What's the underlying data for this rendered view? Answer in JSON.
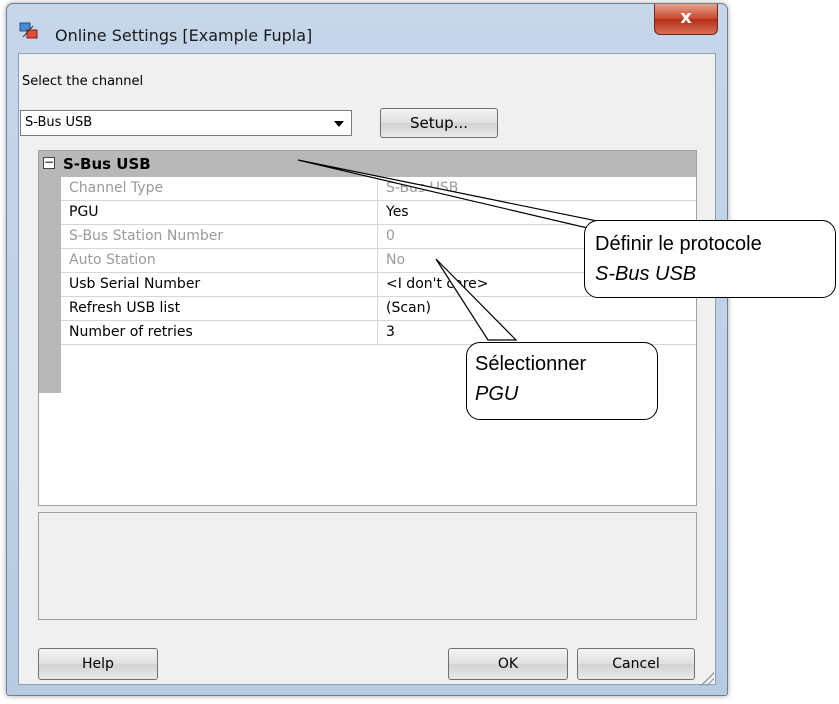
{
  "window": {
    "title": "Online Settings [Example Fupla]",
    "close_label": "x"
  },
  "channel": {
    "label": "Select the channel",
    "selected": "S-Bus USB",
    "setup_label": "Setup..."
  },
  "grid": {
    "header": "S-Bus USB",
    "toggle": "−",
    "rows": [
      {
        "name": "Channel Type",
        "value": "S-Bus USB"
      },
      {
        "name": "PGU",
        "value": "Yes"
      },
      {
        "name": "S-Bus Station Number",
        "value": "0"
      },
      {
        "name": "Auto Station",
        "value": "No"
      },
      {
        "name": "Usb Serial Number",
        "value": "<I don't care>"
      },
      {
        "name": "Refresh USB list",
        "value": "(Scan)"
      },
      {
        "name": "Number of retries",
        "value": "3"
      }
    ]
  },
  "buttons": {
    "help": "Help",
    "ok": "OK",
    "cancel": "Cancel"
  },
  "callouts": {
    "protocol_line1": "Définir le protocole",
    "protocol_line2": "S-Bus USB",
    "pgu_line1": "Sélectionner",
    "pgu_line2": "PGU"
  }
}
